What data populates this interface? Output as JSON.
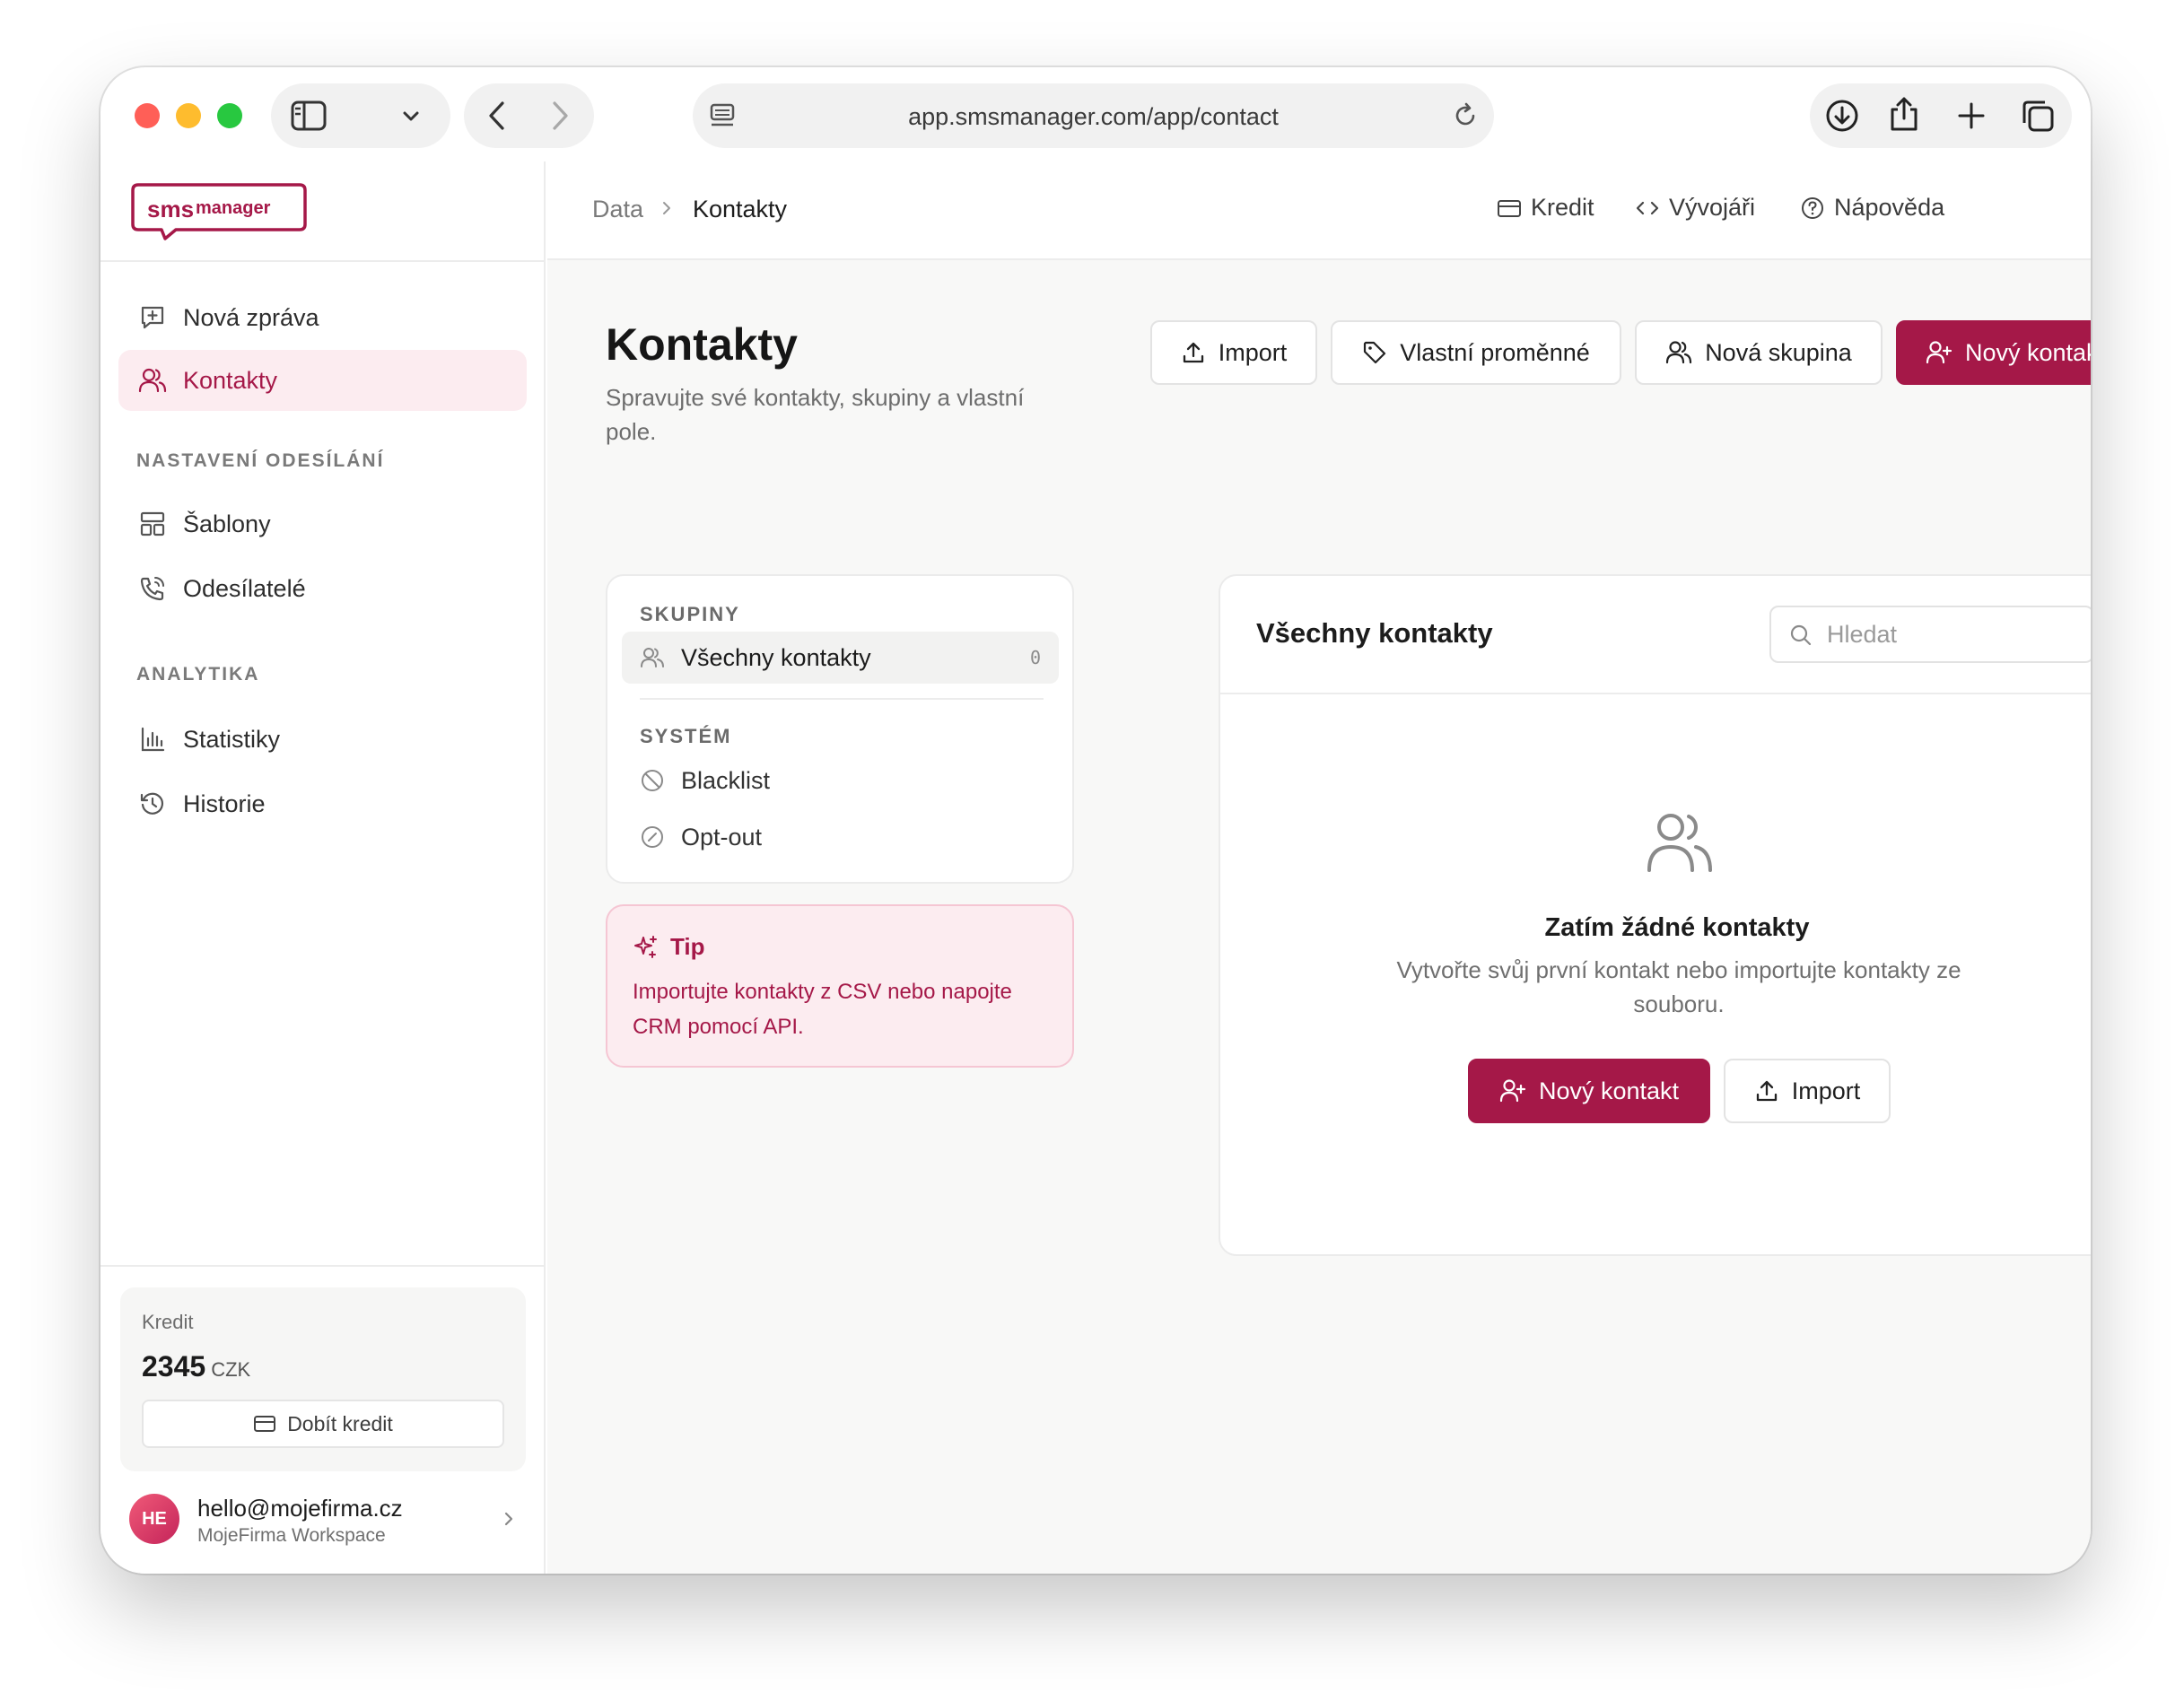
{
  "browser": {
    "url": "app.smsmanager.com/app/contact"
  },
  "brand": {
    "logo_sms": "sms",
    "logo_manager": "manager",
    "accent": "#a51848"
  },
  "sidebar": {
    "nav": [
      {
        "label": "Nová zpráva",
        "icon": "message-plus-icon"
      },
      {
        "label": "Kontakty",
        "icon": "users-icon",
        "active": true
      }
    ],
    "section_sending": "NASTAVENÍ ODESÍLÁNÍ",
    "sending_items": [
      {
        "label": "Šablony",
        "icon": "template-icon"
      },
      {
        "label": "Odesílatelé",
        "icon": "phone-call-icon"
      }
    ],
    "section_analytics": "ANALYTIKA",
    "analytics_items": [
      {
        "label": "Statistiky",
        "icon": "bar-chart-icon"
      },
      {
        "label": "Historie",
        "icon": "history-icon"
      }
    ],
    "credit": {
      "label": "Kredit",
      "amount": "2345",
      "currency": "CZK",
      "topup_label": "Dobít kredit"
    },
    "user": {
      "initials": "HE",
      "email": "hello@mojefirma.cz",
      "workspace": "MojeFirma Workspace"
    }
  },
  "topbar": {
    "breadcrumb": [
      "Data",
      "Kontakty"
    ],
    "links": [
      "Kredit",
      "Vývojáři",
      "Nápověda"
    ]
  },
  "page": {
    "title": "Kontakty",
    "subtitle": "Spravujte své kontakty, skupiny a vlastní pole.",
    "actions": {
      "import": "Import",
      "custom_vars": "Vlastní proměnné",
      "new_group": "Nová skupina",
      "new_contact": "Nový kontakt"
    }
  },
  "groups": {
    "section_groups": "SKUPINY",
    "all_contacts": {
      "label": "Všechny kontakty",
      "count": "0"
    },
    "section_system": "SYSTÉM",
    "system_items": [
      {
        "label": "Blacklist",
        "icon": "ban-icon"
      },
      {
        "label": "Opt-out",
        "icon": "slash-circle-icon"
      }
    ]
  },
  "tip": {
    "title": "Tip",
    "text": "Importujte kontakty z CSV nebo napojte CRM pomocí API."
  },
  "contacts": {
    "title": "Všechny kontakty",
    "search_placeholder": "Hledat",
    "empty_title": "Zatím žádné kontakty",
    "empty_text": "Vytvořte svůj první kontakt nebo importujte kontakty ze souboru.",
    "empty_new_contact": "Nový kontakt",
    "empty_import": "Import"
  }
}
